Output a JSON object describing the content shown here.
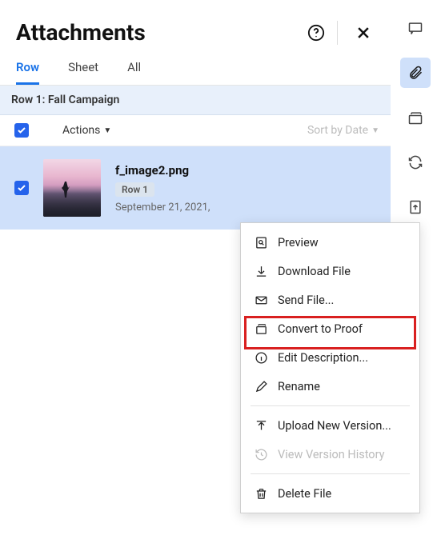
{
  "header": {
    "title": "Attachments"
  },
  "tabs": {
    "row": "Row",
    "sheet": "Sheet",
    "all": "All"
  },
  "row_info": {
    "label": "Row 1: Fall Campaign"
  },
  "toolbar": {
    "actions_label": "Actions",
    "sort_label": "Sort by Date"
  },
  "attachment": {
    "filename": "f_image2.png",
    "row_badge": "Row 1",
    "date": "September 21, 2021,"
  },
  "context_menu": {
    "preview": "Preview",
    "download": "Download File",
    "send": "Send File...",
    "convert": "Convert to Proof",
    "edit_desc": "Edit Description...",
    "rename": "Rename",
    "upload_new": "Upload New Version...",
    "history": "View Version History",
    "delete": "Delete File"
  },
  "rail": {
    "comments": "comments-icon",
    "attachments": "attachment-icon",
    "proofs": "proof-icon",
    "refresh": "refresh-icon",
    "export": "export-icon"
  }
}
